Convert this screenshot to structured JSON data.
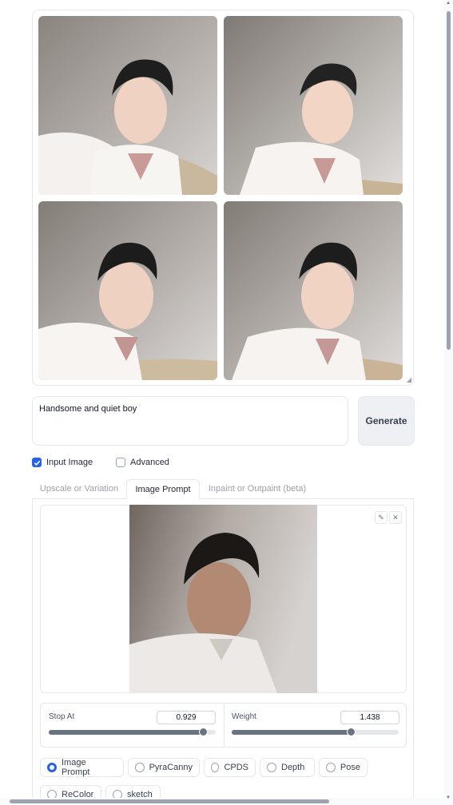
{
  "gallery": {
    "images": [
      {
        "alt": "generated-portrait-1"
      },
      {
        "alt": "generated-portrait-2"
      },
      {
        "alt": "generated-portrait-3"
      },
      {
        "alt": "generated-portrait-4"
      }
    ]
  },
  "prompt": {
    "value": "Handsome and quiet boy"
  },
  "generate": {
    "label": "Generate"
  },
  "options": {
    "input_image": {
      "label": "Input Image",
      "checked": true
    },
    "advanced": {
      "label": "Advanced",
      "checked": false
    }
  },
  "tabs": [
    {
      "label": "Upscale or Variation",
      "active": false
    },
    {
      "label": "Image Prompt",
      "active": true
    },
    {
      "label": "Inpaint or Outpaint (beta)",
      "active": false
    }
  ],
  "image_prompt": {
    "edit_icon": "pencil-icon",
    "clear_icon": "close-icon",
    "stop_at": {
      "label": "Stop At",
      "value": "0.929",
      "fraction": 0.929
    },
    "weight": {
      "label": "Weight",
      "value": "1.438",
      "fraction": 0.719
    },
    "types": [
      {
        "label": "Image Prompt",
        "selected": true
      },
      {
        "label": "PyraCanny",
        "selected": false
      },
      {
        "label": "CPDS",
        "selected": false
      },
      {
        "label": "Depth",
        "selected": false
      },
      {
        "label": "Pose",
        "selected": false
      },
      {
        "label": "ReColor",
        "selected": false
      },
      {
        "label": "sketch",
        "selected": false
      }
    ]
  },
  "colors": {
    "accent": "#2563eb",
    "slider": "#6b7280",
    "border": "#e5e7eb"
  }
}
